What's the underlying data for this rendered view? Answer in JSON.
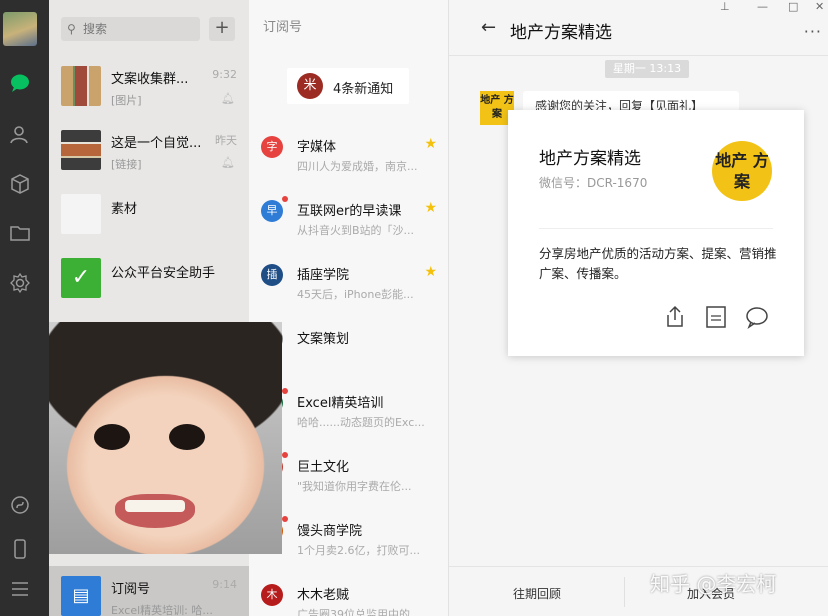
{
  "sidebar": {
    "icons": [
      "chat-icon",
      "contacts-icon",
      "box-icon",
      "folder-icon",
      "settings-icon",
      "miniprogram-icon",
      "phone-icon",
      "menu-icon"
    ]
  },
  "chatlist": {
    "search_placeholder": "搜索",
    "plus_label": "+",
    "items": [
      {
        "name": "文案收集群...",
        "time": "9:32",
        "sub": "[图片]"
      },
      {
        "name": "这是一个自觉...",
        "time": "昨天",
        "sub": "[链接]"
      },
      {
        "name": "素材",
        "time": "",
        "sub": ""
      },
      {
        "name": "公众平台安全助手",
        "time": "",
        "sub": ""
      },
      {
        "name": "订阅号",
        "time": "9:14",
        "sub": "Excel精英培训: 哈..."
      }
    ]
  },
  "sublist": {
    "header": "订阅号",
    "notice_logo": "米",
    "notice_text": "4条新通知",
    "items": [
      {
        "name": "字媒体",
        "desc": "四川人为爱成婚，南京...",
        "icon": "字",
        "color": "#e64340",
        "star": true,
        "dot": false
      },
      {
        "name": "互联网er的早读课",
        "desc": "从抖音火到B站的「沙...",
        "icon": "早",
        "color": "#2f7cd6",
        "star": true,
        "dot": true
      },
      {
        "name": "插座学院",
        "desc": "45天后，iPhone彭能...",
        "icon": "插",
        "color": "#1f4e86",
        "star": true,
        "dot": false
      },
      {
        "name": "文案策划",
        "desc": "",
        "icon": "文",
        "color": "#888888",
        "star": false,
        "dot": false
      },
      {
        "name": "Excel精英培训",
        "desc": "哈哈......动态题页的Exc...",
        "icon": "E",
        "color": "#1e7145",
        "star": false,
        "dot": true
      },
      {
        "name": "巨土文化",
        "desc": "\"我知道你用字费在伦...",
        "icon": "巨",
        "color": "#c0392b",
        "star": false,
        "dot": true
      },
      {
        "name": "馒头商学院",
        "desc": "1个月卖2.6亿，打败可...",
        "icon": "馒",
        "color": "#d35400",
        "star": false,
        "dot": true
      },
      {
        "name": "木木老贼",
        "desc": "广告圈39位总监用中的...",
        "icon": "木",
        "color": "#b71c1c",
        "star": false,
        "dot": false
      }
    ]
  },
  "main": {
    "back": "←",
    "title": "地产方案精选",
    "more": "···",
    "timestamp": "星期一 13:13",
    "avatar_text": "地产 方案",
    "bubble": "感谢您的关注，回复【见面礼】",
    "card": {
      "name": "地产方案精选",
      "wechat_id": "微信号：DCR-1670",
      "logo_text": "地产 方案",
      "description": "分享房地产优质的活动方案、提案、营销推广案、传播案。"
    },
    "bottom": {
      "history": "往期回顾",
      "join": "加入会员"
    },
    "watermark": "知乎 @李宏柯",
    "win_pin": "⊥",
    "win_min": "—",
    "win_max": "□",
    "win_close": "✕"
  }
}
